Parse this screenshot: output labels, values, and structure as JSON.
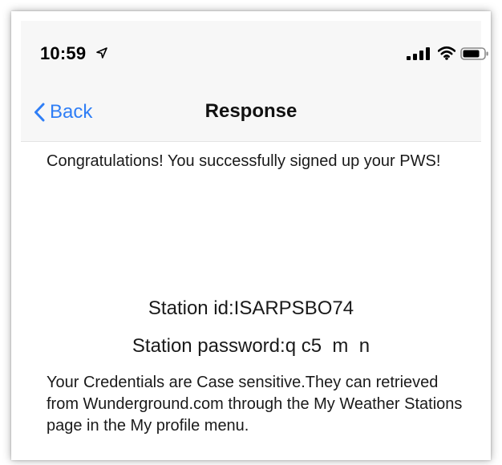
{
  "status_bar": {
    "time": "10:59"
  },
  "nav": {
    "back_label": "Back",
    "title": "Response"
  },
  "content": {
    "success_message": "Congratulations! You successfully signed up your PWS!",
    "station_id_line": "Station id:ISARPSBO74",
    "station_password_line": "Station password:q c5  m  n",
    "credentials_note": "Your Credentials are Case sensitive.They can retrieved from Wunderground.com through the My Weather Stations page in the My profile menu."
  },
  "colors": {
    "accent": "#2f7ef6",
    "navbar_background": "#f7f7f7",
    "text": "#1a1a1a"
  },
  "icons": {
    "location": "location-arrow-icon",
    "signal": "cellular-signal-icon",
    "wifi": "wifi-icon",
    "battery": "battery-icon",
    "back": "chevron-left-icon"
  }
}
